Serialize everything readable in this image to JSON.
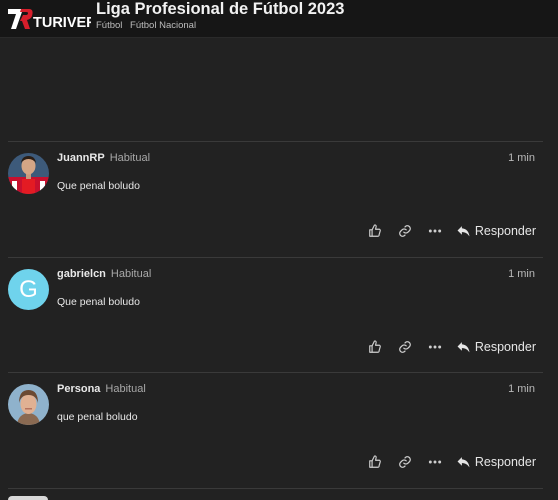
{
  "header": {
    "logo_text": "TURIVER",
    "title": "Liga Profesional de Fútbol 2023",
    "breadcrumbs": [
      "Fútbol",
      "Fútbol Nacional"
    ]
  },
  "posts": [
    {
      "username": "JuannRP",
      "user_title": "Habitual",
      "time": "1 min",
      "content": "Que penal boludo",
      "avatar": "player-photo",
      "reply_label": "Responder"
    },
    {
      "username": "gabrielcn",
      "user_title": "Habitual",
      "time": "1 min",
      "content": "Que penal boludo",
      "avatar_letter": "G",
      "avatar_color": "#6fd3ec",
      "reply_label": "Responder"
    },
    {
      "username": "Persona",
      "user_title": "Habitual",
      "time": "1 min",
      "content": "que penal boludo",
      "avatar": "person-photo",
      "reply_label": "Responder"
    }
  ],
  "icons": [
    "like-icon",
    "link-icon",
    "more-icon",
    "reply-icon"
  ],
  "colors": {
    "background": "#222222",
    "header": "#161616",
    "divider": "#3a3a3a",
    "letter_avatar": "#6fd3ec"
  }
}
